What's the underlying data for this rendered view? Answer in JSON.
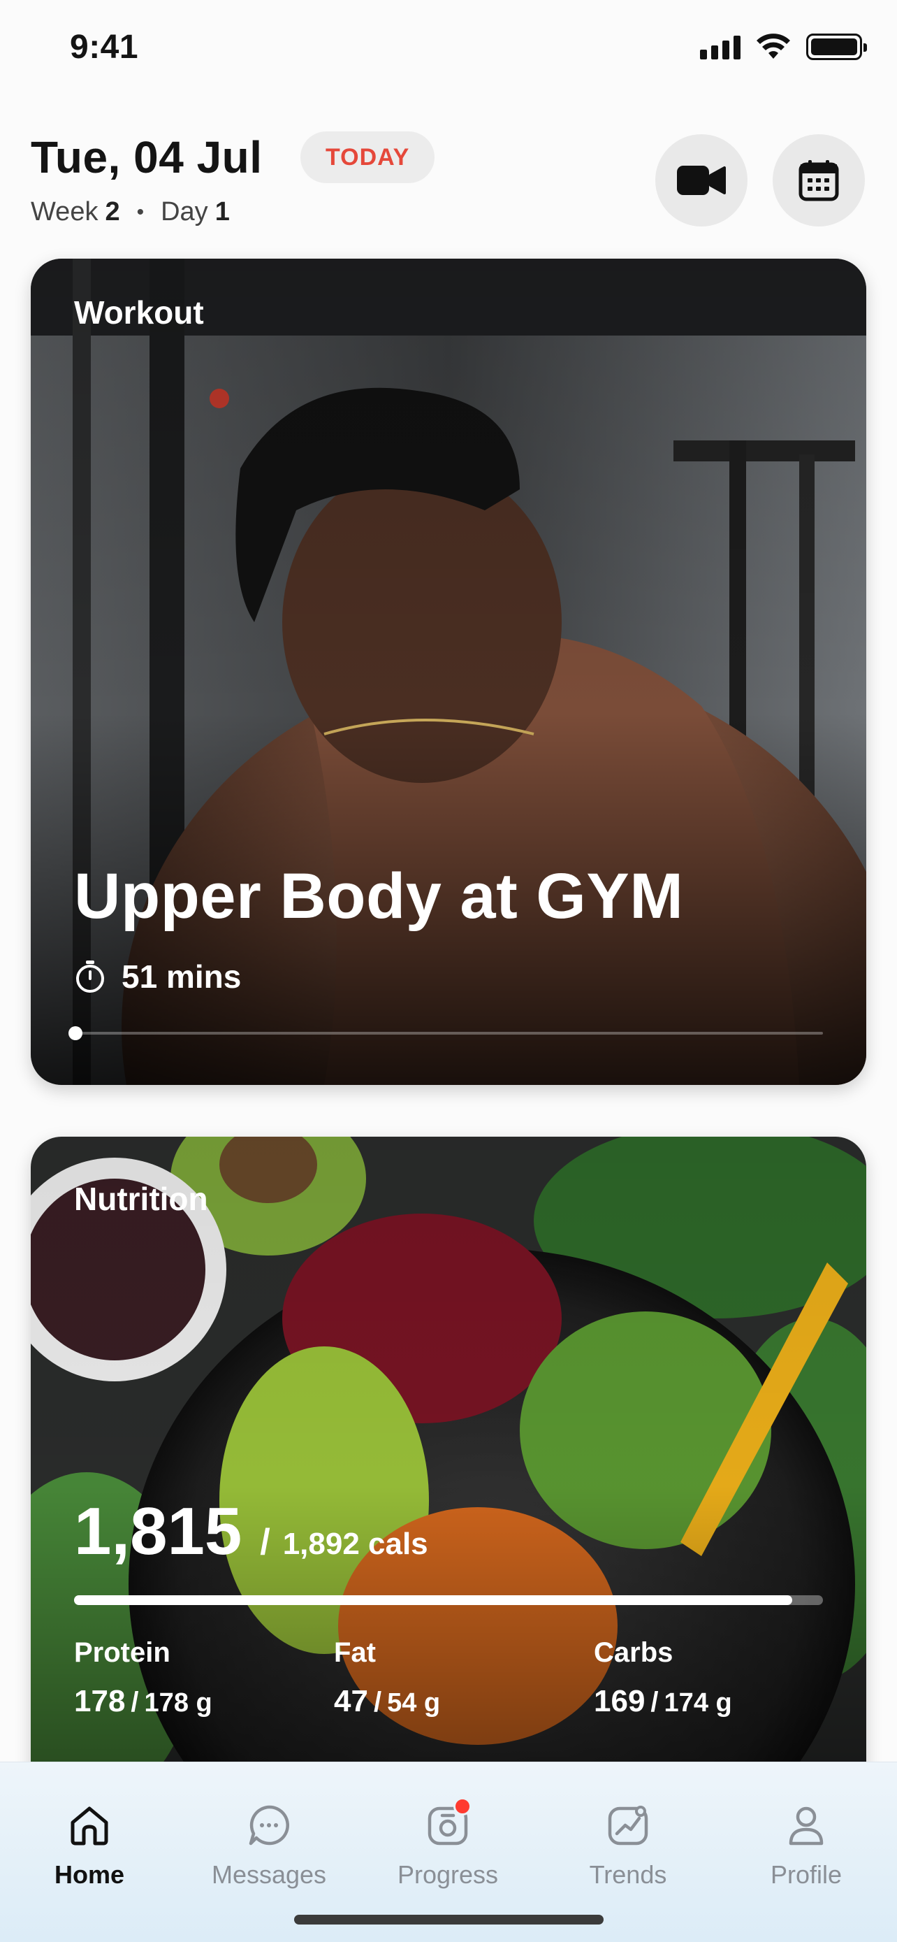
{
  "status_bar": {
    "time": "9:41"
  },
  "header": {
    "date": "Tue, 04 Jul",
    "today_badge": "TODAY",
    "week_label": "Week",
    "week_number": "2",
    "day_label": "Day",
    "day_number": "1"
  },
  "workout": {
    "label": "Workout",
    "title": "Upper Body at GYM",
    "duration": "51 mins",
    "progress": 0.0
  },
  "nutrition": {
    "label": "Nutrition",
    "consumed": "1,815",
    "separator": "/",
    "target": "1,892 cals",
    "calorie_progress": 0.959,
    "macros": [
      {
        "name": "Protein",
        "value": "178",
        "target": "178 g"
      },
      {
        "name": "Fat",
        "value": "47",
        "target": "54 g"
      },
      {
        "name": "Carbs",
        "value": "169",
        "target": "174 g"
      }
    ],
    "macro_separator": "/"
  },
  "tabs": [
    {
      "label": "Home",
      "icon": "home-icon",
      "active": true
    },
    {
      "label": "Messages",
      "icon": "chat-bubble-icon",
      "active": false
    },
    {
      "label": "Progress",
      "icon": "camera-icon",
      "active": false,
      "badge": true
    },
    {
      "label": "Trends",
      "icon": "trend-chart-icon",
      "active": false
    },
    {
      "label": "Profile",
      "icon": "person-icon",
      "active": false
    }
  ],
  "colors": {
    "today_badge_text": "#e5483a",
    "badge_dot": "#ff3b30",
    "tab_active": "#111111",
    "tab_inactive": "#8a8f96"
  }
}
